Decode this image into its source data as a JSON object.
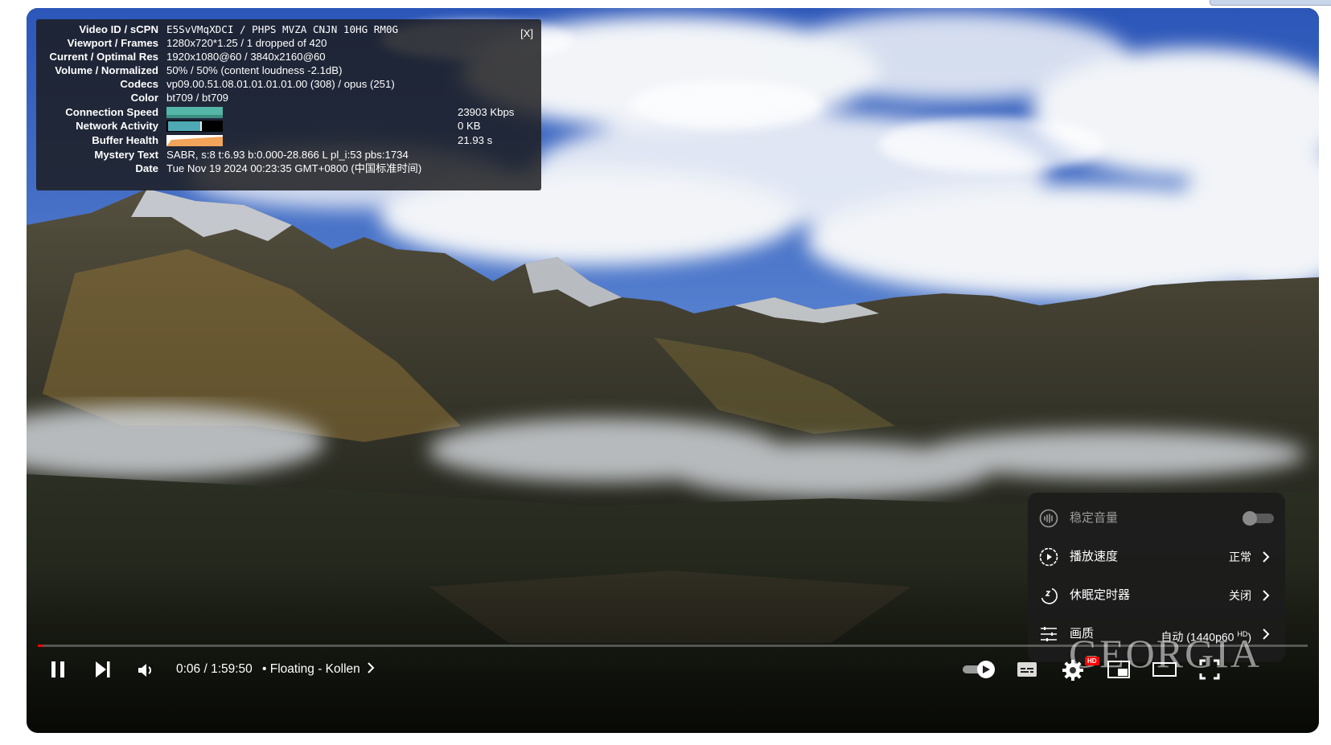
{
  "stats": {
    "close_label": "[X]",
    "rows": [
      {
        "label": "Video ID / sCPN",
        "value": "E5SvVMqXDCI  /  PHPS MVZA CNJN 10HG RM0G"
      },
      {
        "label": "Viewport / Frames",
        "value": "1280x720*1.25 / 1 dropped of 420"
      },
      {
        "label": "Current / Optimal Res",
        "value": "1920x1080@60 / 3840x2160@60"
      },
      {
        "label": "Volume / Normalized",
        "value": "50% / 50% (content loudness -2.1dB)"
      },
      {
        "label": "Codecs",
        "value": "vp09.00.51.08.01.01.01.01.00 (308) / opus (251)"
      },
      {
        "label": "Color",
        "value": "bt709 / bt709"
      },
      {
        "label": "Connection Speed",
        "value": "23903 Kbps"
      },
      {
        "label": "Network Activity",
        "value": "0 KB"
      },
      {
        "label": "Buffer Health",
        "value": "21.93 s"
      },
      {
        "label": "Mystery Text",
        "value": "SABR, s:8 t:6.93 b:0.000-28.866 L pl_i:53 pbs:1734"
      },
      {
        "label": "Date",
        "value": "Tue Nov 19 2024 00:23:35 GMT+0800 (中国标准时间)"
      }
    ]
  },
  "settings_menu": {
    "items": [
      {
        "label": "稳定音量",
        "value": "",
        "icon": "stable-volume-icon",
        "toggle": false
      },
      {
        "label": "播放速度",
        "value": "正常",
        "icon": "playback-speed-icon"
      },
      {
        "label": "休眠定时器",
        "value": "关闭",
        "icon": "sleep-timer-icon"
      },
      {
        "label": "画质",
        "value": "自动 (1440p60 ",
        "value_sup": "HD",
        "value_end": ")",
        "icon": "quality-icon"
      }
    ]
  },
  "player": {
    "current_time": "0:06",
    "separator": "/",
    "duration": "1:59:50",
    "time_display": "0:06 / 1:59:50",
    "chapter_bullet": "•",
    "chapter_title": "Floating - Kollen",
    "progress_fraction": 0.0009,
    "buffer_fraction": 0.004,
    "settings_badge": "HD",
    "watermark": "GEORGIA",
    "accent_color": "#ff0000"
  },
  "icons": [
    "pause-icon",
    "next-icon",
    "volume-icon",
    "autoplay-toggle-icon",
    "subtitles-icon",
    "settings-icon",
    "miniplayer-icon",
    "theater-mode-icon",
    "fullscreen-icon",
    "chevron-right-icon"
  ]
}
